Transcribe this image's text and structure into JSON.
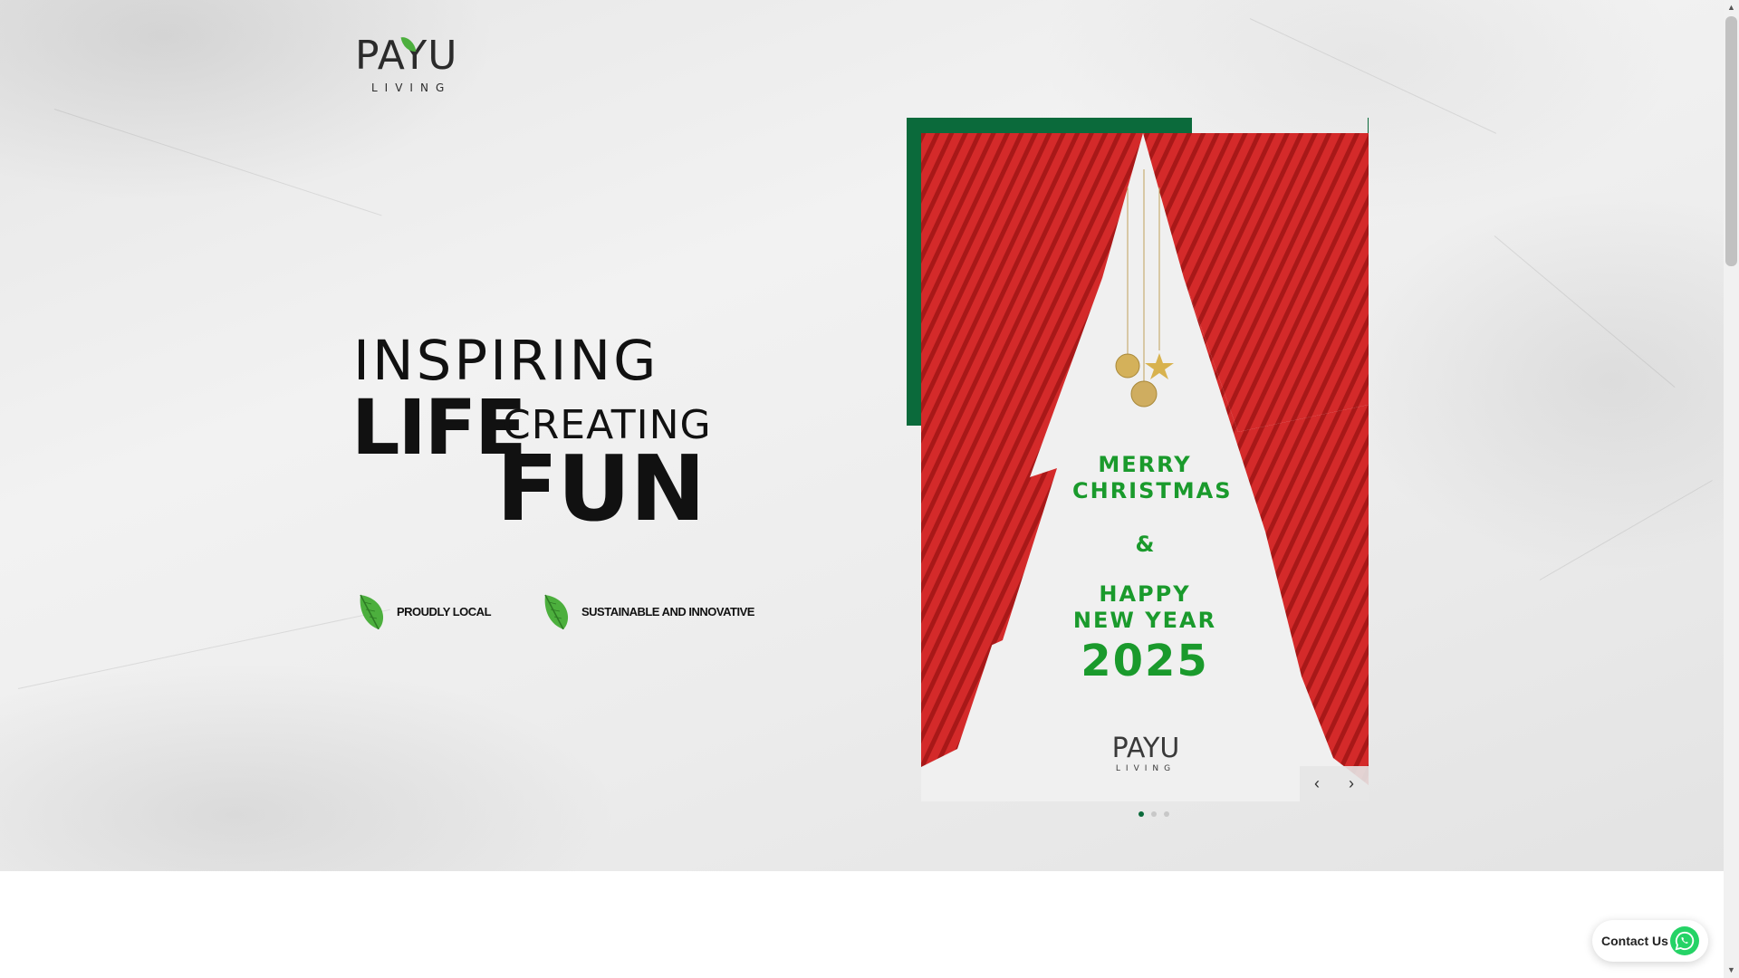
{
  "brand": {
    "logo_word": "PAYU",
    "logo_sub": "LIVING"
  },
  "headline": {
    "line1": "INSPIRING",
    "line2": "LIFE",
    "line3": "CREATING",
    "line4": "FUN"
  },
  "features": [
    {
      "label": "PROUDLY LOCAL"
    },
    {
      "label": "SUSTAINABLE AND INNOVATIVE"
    }
  ],
  "slide": {
    "greeting1": "MERRY CHRISTMAS",
    "amp": "&",
    "greeting2": "HAPPY NEW YEAR",
    "year": "2025",
    "logo_word": "PAYU",
    "logo_sub": "LIVING"
  },
  "carousel": {
    "prev": "‹",
    "next": "›",
    "slide_count": 3,
    "active_index": 0
  },
  "contact": {
    "label": "Contact Us"
  },
  "colors": {
    "brand_green": "#0b6a3b",
    "leaf_green": "#4caf3d",
    "text_green": "#1a9a2c",
    "red": "#d42a2a",
    "whatsapp": "#25d366"
  }
}
